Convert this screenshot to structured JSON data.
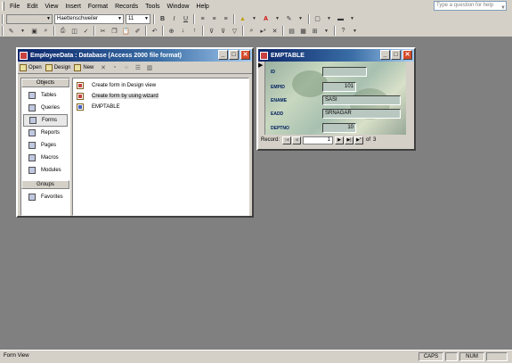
{
  "menu": {
    "items": [
      "File",
      "Edit",
      "View",
      "Insert",
      "Format",
      "Records",
      "Tools",
      "Window",
      "Help"
    ],
    "help_placeholder": "Type a question for help"
  },
  "toolbar": {
    "font_name": "Haettenschweiler",
    "font_size": "11",
    "bold": "B",
    "italic": "I",
    "underline": "U"
  },
  "db_window": {
    "title": "EmployeeData : Database (Access 2000 file format)",
    "open_label": "Open",
    "design_label": "Design",
    "new_label": "New",
    "objects_header": "Objects",
    "groups_header": "Groups",
    "objects": [
      "Tables",
      "Queries",
      "Forms",
      "Reports",
      "Pages",
      "Macros",
      "Modules"
    ],
    "selected_object": "Forms",
    "favorites": "Favorites",
    "list": [
      "Create form in Design view",
      "Create form by using wizard",
      "EMPTABLE"
    ]
  },
  "form_window": {
    "title": "EMPTABLE",
    "fields": [
      {
        "label": "ID",
        "value": ""
      },
      {
        "label": "EMPID",
        "value": "101"
      },
      {
        "label": "ENAME",
        "value": "SASI"
      },
      {
        "label": "EADD",
        "value": "SRNAGAR"
      },
      {
        "label": "DEPTNO",
        "value": "10"
      }
    ],
    "record_label": "Record:",
    "record_number": "1",
    "of_label": "of",
    "record_total": "3"
  },
  "status": {
    "text": "Form View",
    "caps": "CAPS",
    "num": "NUM"
  }
}
